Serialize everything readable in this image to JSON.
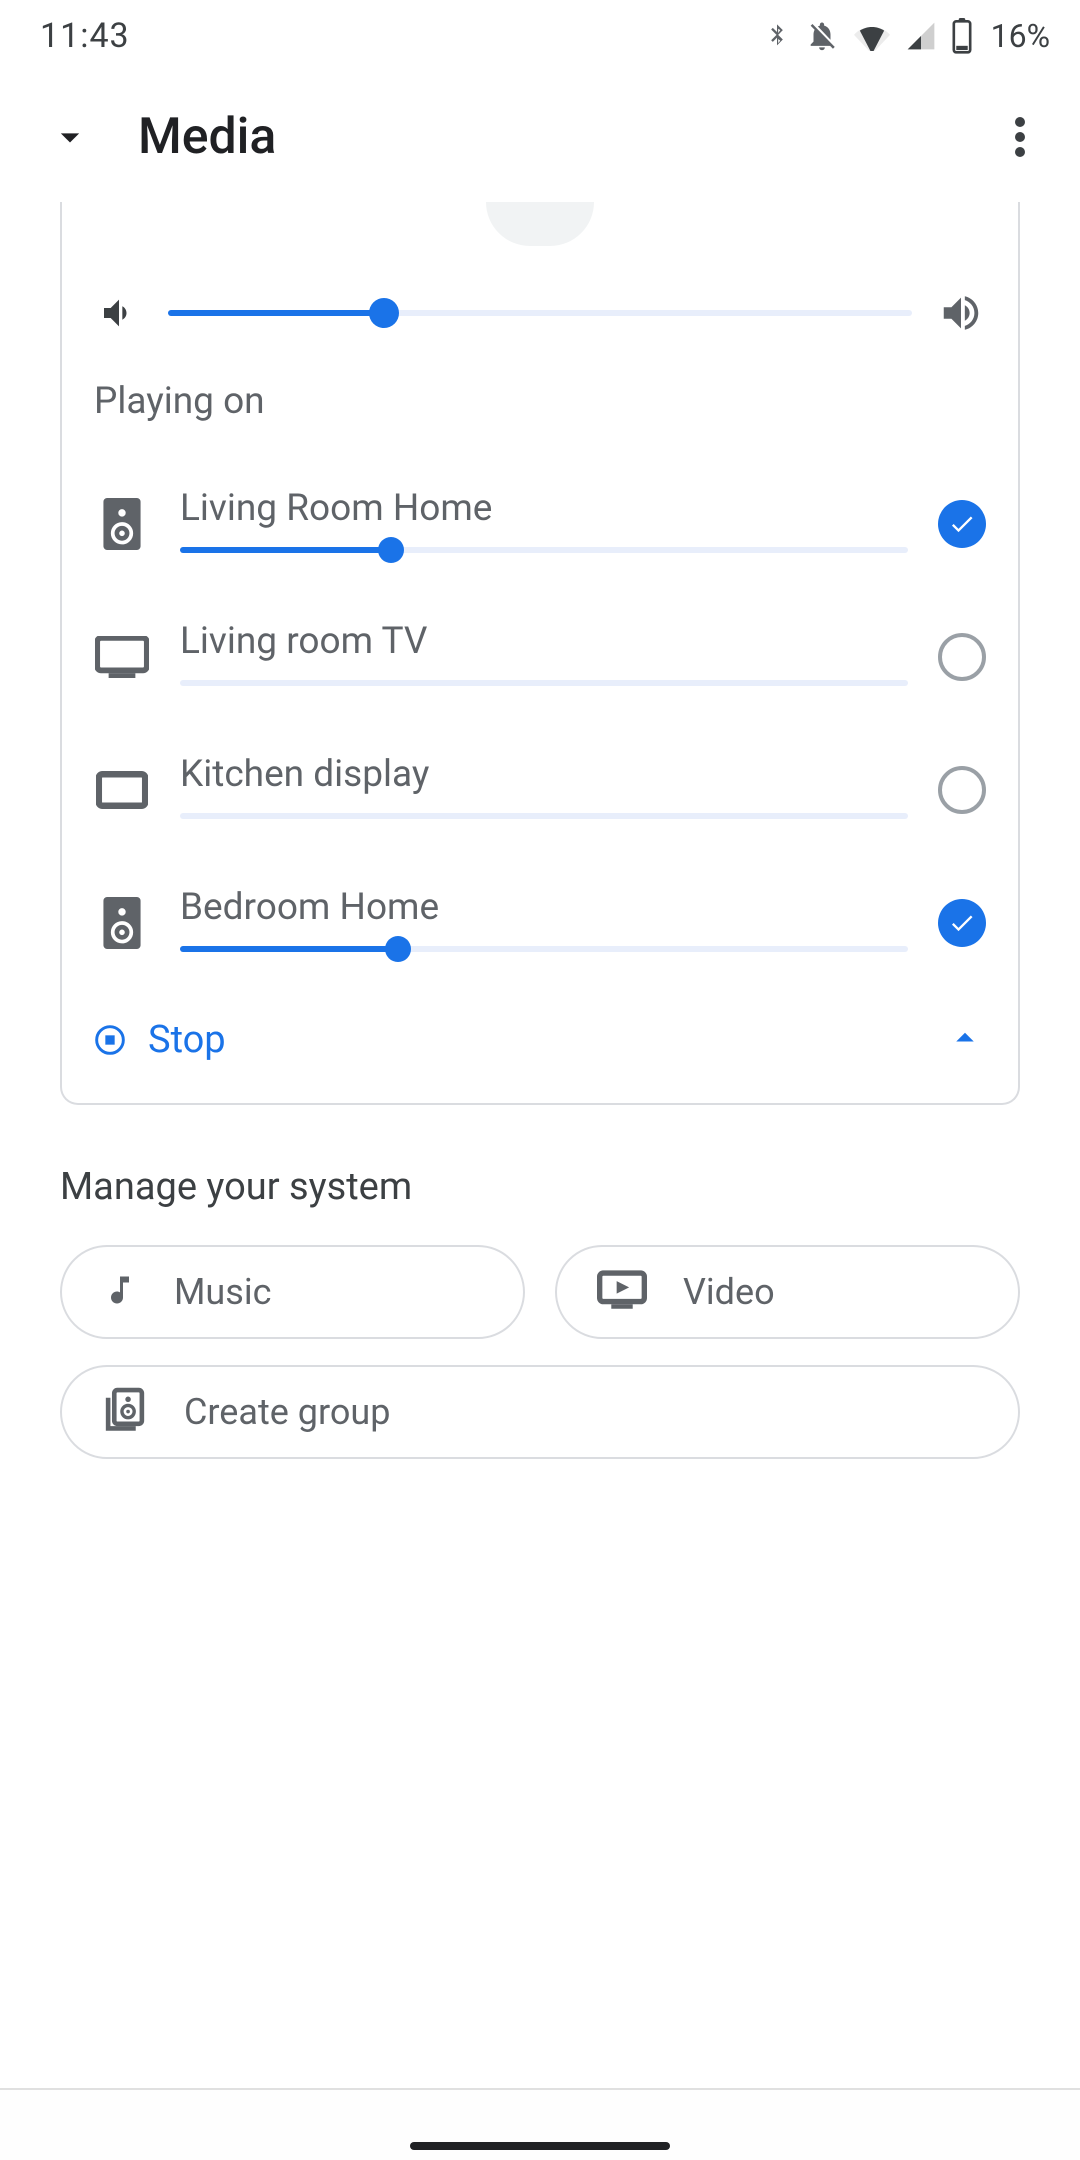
{
  "status": {
    "time": "11:43",
    "battery_text": "16%"
  },
  "appbar": {
    "title": "Media"
  },
  "player": {
    "master_volume_percent": 29,
    "playing_on_label": "Playing on",
    "stop_label": "Stop",
    "devices": [
      {
        "name": "Living Room Home",
        "icon": "speaker",
        "selected": true,
        "volume_percent": 29,
        "slider_enabled": true
      },
      {
        "name": "Living room TV",
        "icon": "tv",
        "selected": false,
        "volume_percent": 0,
        "slider_enabled": false
      },
      {
        "name": "Kitchen display",
        "icon": "tablet",
        "selected": false,
        "volume_percent": 0,
        "slider_enabled": false
      },
      {
        "name": "Bedroom Home",
        "icon": "speaker",
        "selected": true,
        "volume_percent": 30,
        "slider_enabled": true
      }
    ]
  },
  "manage": {
    "title": "Manage your system",
    "chips": {
      "music": "Music",
      "video": "Video",
      "create_group": "Create group"
    }
  }
}
